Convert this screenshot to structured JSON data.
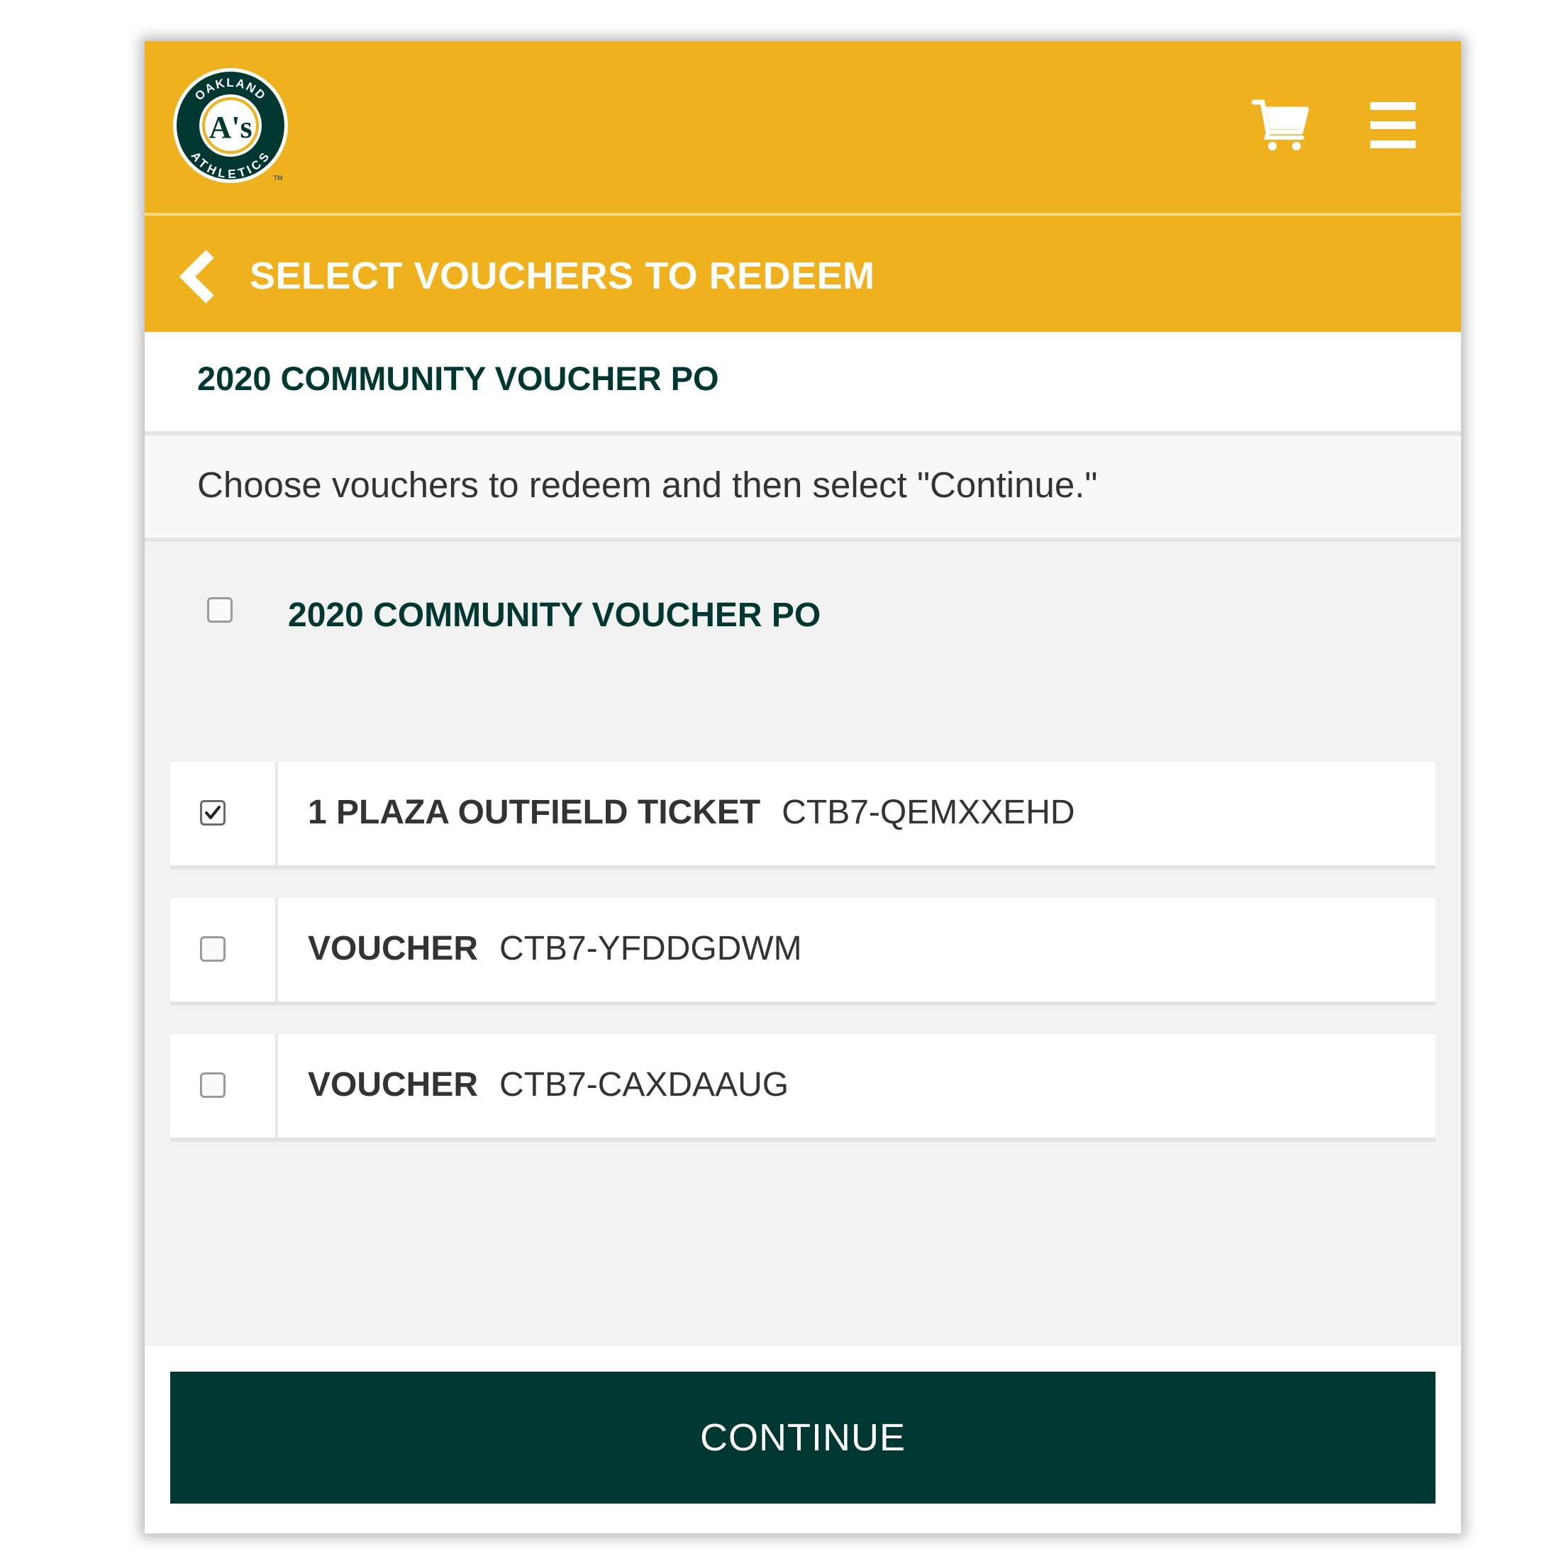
{
  "header": {
    "logo": {
      "top_text": "OAKLAND",
      "bottom_text": "ATHLETICS",
      "monogram": "A's",
      "trademark": "TM"
    },
    "cart_icon": "shopping-cart-icon",
    "menu_icon": "hamburger-menu-icon"
  },
  "titlebar": {
    "back_icon": "chevron-left-icon",
    "title": "SELECT VOUCHERS TO REDEEM"
  },
  "po_heading": "2020 COMMUNITY VOUCHER PO",
  "instructions": "Choose vouchers to redeem and then select \"Continue.\"",
  "group": {
    "label": "2020 COMMUNITY VOUCHER PO",
    "checked": false
  },
  "vouchers": [
    {
      "name": "1 PLAZA OUTFIELD TICKET",
      "code": "CTB7-QEMXXEHD",
      "checked": true
    },
    {
      "name": "VOUCHER",
      "code": "CTB7-YFDDGDWM",
      "checked": false
    },
    {
      "name": "VOUCHER",
      "code": "CTB7-CAXDAAUG",
      "checked": false
    }
  ],
  "footer": {
    "continue_label": "CONTINUE"
  },
  "colors": {
    "brand_gold": "#efb21e",
    "brand_green": "#003831",
    "panel_gray": "#f2f2f2",
    "white": "#ffffff"
  }
}
